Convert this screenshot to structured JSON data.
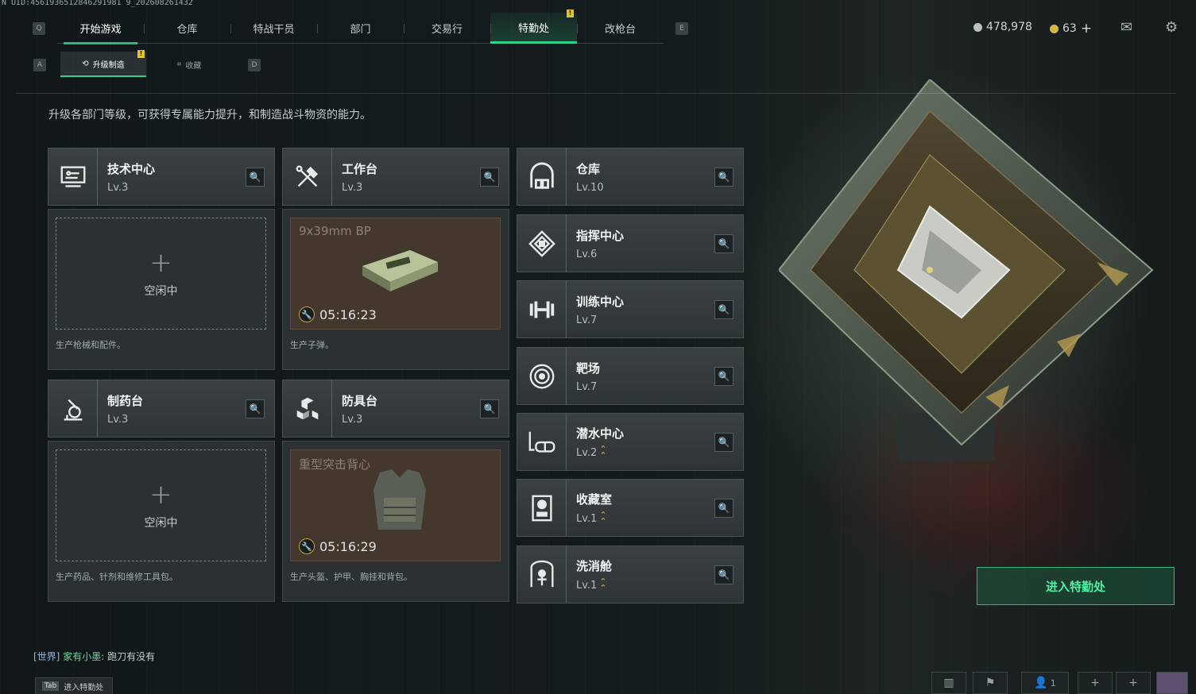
{
  "uid": "N UID:4561936512846291981 9_202608261432",
  "nav": {
    "left_key": "Q",
    "right_key": "E",
    "tabs": [
      "开始游戏",
      "仓库",
      "特战干员",
      "部门",
      "交易行",
      "特勤处",
      "改枪台"
    ],
    "active_tab": "特勤处",
    "tab_badge": "!"
  },
  "currency": {
    "silver": "478,978",
    "gold": "63",
    "add": "+"
  },
  "subnav": {
    "left_key": "A",
    "right_key": "D",
    "tabs": [
      "升级制造",
      "收藏"
    ],
    "badge": "!"
  },
  "intro": "升级各部门等级，可获得专属能力提升，和制造战斗物资的能力。",
  "production_cards": [
    {
      "name": "技术中心",
      "level": "Lv.3",
      "icon": "monitor-icon",
      "status": "空闲中",
      "plus": "+",
      "desc": "生产枪械和配件。"
    },
    {
      "name": "工作台",
      "level": "Lv.3",
      "icon": "tools-icon",
      "item": "9x39mm BP",
      "timer": "05:16:23",
      "desc": "生产子弹。"
    },
    {
      "name": "制药台",
      "level": "Lv.3",
      "icon": "microscope-icon",
      "status": "空闲中",
      "plus": "+",
      "desc": "生产药品、针剂和维修工具包。"
    },
    {
      "name": "防具台",
      "level": "Lv.3",
      "icon": "boxes-icon",
      "item": "重型突击背心",
      "timer": "05:16:29",
      "desc": "生产头盔、护甲、胸挂和背包。"
    }
  ],
  "facilities": [
    {
      "name": "仓库",
      "level": "Lv.10",
      "icon": "warehouse-icon",
      "upgradable": false
    },
    {
      "name": "指挥中心",
      "level": "Lv.6",
      "icon": "command-icon",
      "upgradable": false
    },
    {
      "name": "训练中心",
      "level": "Lv.7",
      "icon": "dumbbell-icon",
      "upgradable": false
    },
    {
      "name": "靶场",
      "level": "Lv.7",
      "icon": "target-icon",
      "upgradable": false
    },
    {
      "name": "潜水中心",
      "level": "Lv.2",
      "icon": "goggles-icon",
      "upgradable": true
    },
    {
      "name": "收藏室",
      "level": "Lv.1",
      "icon": "showcase-icon",
      "upgradable": true
    },
    {
      "name": "洗消舱",
      "level": "Lv.1",
      "icon": "decon-icon",
      "upgradable": true
    }
  ],
  "enter_button": "进入特勤处",
  "chat": {
    "channel": "[世界]",
    "user": "家有小墨:",
    "message": "跑刀有没有"
  },
  "tab_hint": {
    "key": "Tab",
    "label": "进入特勤处"
  },
  "bottom_bar": {
    "friends_count": "1"
  },
  "colors": {
    "accent": "#2fd089",
    "badge": "#e5c22b",
    "upgrade": "#d7b544"
  }
}
